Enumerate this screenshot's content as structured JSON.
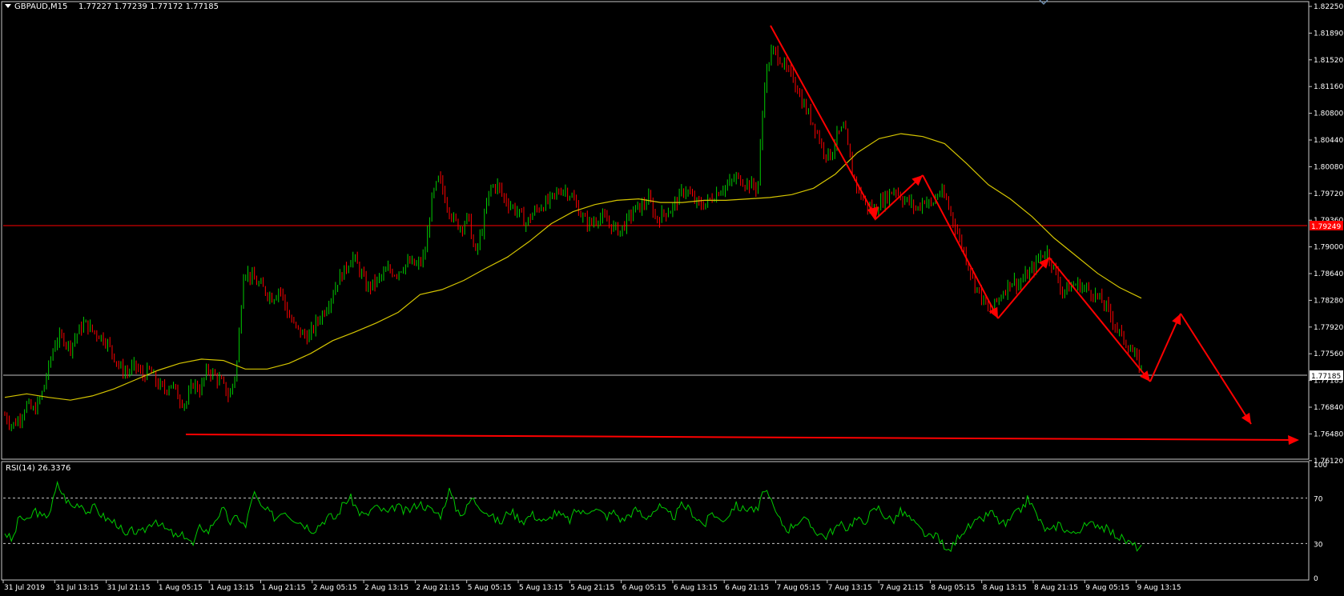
{
  "header": {
    "title": "GBPAUD,M15",
    "ohlc": "1.77227 1.77239 1.77172 1.77185"
  },
  "indicator_label": "RSI(14) 26.3376",
  "colors": {
    "background": "#000000",
    "bull_candle": "#00cc00",
    "bear_candle": "#ff0000",
    "moving_average": "#d4c400",
    "rsi_line": "#00cc00",
    "annotation": "#ff0000",
    "level_line": "#ff0000",
    "bid_line": "#c0c0c0",
    "axis_text": "#ffffff"
  },
  "price_axis": {
    "labels": [
      "1.82250",
      "1.81890",
      "1.81520",
      "1.81160",
      "1.80800",
      "1.80440",
      "1.80080",
      "1.79720",
      "1.79360",
      "1.79000",
      "1.78640",
      "1.78280",
      "1.77920",
      "1.77560",
      "1.77185",
      "1.76840",
      "1.76480",
      "1.76120"
    ],
    "level_tag": "1.79249",
    "bid_tag": "1.77185"
  },
  "rsi_axis": {
    "labels": [
      "100",
      "70",
      "30",
      "0"
    ]
  },
  "time_axis": {
    "labels": [
      "31 Jul 2019",
      "31 Jul 13:15",
      "31 Jul 21:15",
      "1 Aug 05:15",
      "1 Aug 13:15",
      "1 Aug 21:15",
      "2 Aug 05:15",
      "2 Aug 13:15",
      "2 Aug 21:15",
      "5 Aug 05:15",
      "5 Aug 13:15",
      "5 Aug 21:15",
      "6 Aug 05:15",
      "6 Aug 13:15",
      "6 Aug 21:15",
      "7 Aug 05:15",
      "7 Aug 13:15",
      "7 Aug 21:15",
      "8 Aug 05:15",
      "8 Aug 13:15",
      "8 Aug 21:15",
      "9 Aug 05:15",
      "9 Aug 13:15"
    ]
  },
  "chart_data": {
    "type": "candlestick",
    "symbol": "GBPAUD",
    "timeframe": "M15",
    "ylim": [
      1.7595,
      1.8235
    ],
    "levels": {
      "resistance": 1.79249,
      "bid": 1.77185
    },
    "close_path": [
      1.7655,
      1.764,
      1.765,
      1.767,
      1.766,
      1.768,
      1.772,
      1.776,
      1.7765,
      1.775,
      1.777,
      1.7785,
      1.7775,
      1.7768,
      1.776,
      1.774,
      1.772,
      1.7715,
      1.7725,
      1.771,
      1.7718,
      1.77,
      1.769,
      1.77,
      1.768,
      1.767,
      1.77,
      1.769,
      1.772,
      1.771,
      1.77,
      1.768,
      1.772,
      1.786,
      1.785,
      1.784,
      1.783,
      1.782,
      1.7835,
      1.78,
      1.778,
      1.777,
      1.7765,
      1.7785,
      1.78,
      1.782,
      1.7845,
      1.786,
      1.788,
      1.786,
      1.7835,
      1.784,
      1.785,
      1.786,
      1.7855,
      1.7865,
      1.787,
      1.7865,
      1.788,
      1.796,
      1.799,
      1.7955,
      1.793,
      1.792,
      1.7935,
      1.788,
      1.792,
      1.7975,
      1.798,
      1.796,
      1.795,
      1.794,
      1.7925,
      1.794,
      1.795,
      1.7955,
      1.7965,
      1.7975,
      1.7968,
      1.795,
      1.793,
      1.7925,
      1.7935,
      1.793,
      1.792,
      1.7915,
      1.793,
      1.7945,
      1.795,
      1.796,
      1.793,
      1.794,
      1.7945,
      1.796,
      1.7975,
      1.796,
      1.795,
      1.7955,
      1.7965,
      1.7975,
      1.798,
      1.799,
      1.7985,
      1.798,
      1.7975,
      1.813,
      1.817,
      1.816,
      1.814,
      1.813,
      1.81,
      1.808,
      1.806,
      1.803,
      1.802,
      1.805,
      1.806,
      1.8,
      1.797,
      1.795,
      1.7945,
      1.7955,
      1.7965,
      1.7975,
      1.796,
      1.7955,
      1.7945,
      1.796,
      1.795,
      1.797,
      1.796,
      1.793,
      1.79,
      1.787,
      1.784,
      1.782,
      1.78,
      1.7815,
      1.783,
      1.7845,
      1.784,
      1.785,
      1.786,
      1.788,
      1.7885,
      1.786,
      1.783,
      1.7835,
      1.784,
      1.7835,
      1.783,
      1.782,
      1.781,
      1.779,
      1.777,
      1.7755,
      1.774,
      1.77185
    ],
    "ma_path": [
      1.768,
      1.7685,
      1.768,
      1.7676,
      1.7682,
      1.7692,
      1.7705,
      1.7718,
      1.7728,
      1.7734,
      1.7732,
      1.772,
      1.772,
      1.7728,
      1.7742,
      1.776,
      1.7772,
      1.7785,
      1.78,
      1.7825,
      1.7832,
      1.7845,
      1.7862,
      1.7878,
      1.79,
      1.7925,
      1.7942,
      1.7952,
      1.7958,
      1.796,
      1.7955,
      1.7955,
      1.7958,
      1.7958,
      1.796,
      1.7962,
      1.7966,
      1.7975,
      1.7995,
      1.8025,
      1.8045,
      1.8052,
      1.8048,
      1.8038,
      1.801,
      1.798,
      1.796,
      1.7935,
      1.7905,
      1.788,
      1.7855,
      1.7835,
      1.782
    ],
    "rsi": {
      "ylim": [
        0,
        100
      ],
      "levels": [
        70,
        30
      ],
      "last": 26.3376,
      "path": [
        40,
        32,
        55,
        48,
        60,
        52,
        58,
        82,
        70,
        62,
        66,
        58,
        62,
        54,
        50,
        48,
        35,
        42,
        38,
        45,
        52,
        44,
        40,
        35,
        38,
        28,
        46,
        40,
        52,
        60,
        48,
        54,
        44,
        76,
        62,
        58,
        52,
        60,
        54,
        50,
        46,
        42,
        48,
        54,
        52,
        66,
        70,
        58,
        54,
        62,
        60,
        56,
        64,
        58,
        60,
        66,
        62,
        58,
        55,
        78,
        60,
        56,
        70,
        64,
        58,
        52,
        48,
        60,
        54,
        50,
        56,
        52,
        48,
        58,
        54,
        50,
        60,
        56,
        62,
        58,
        54,
        58,
        50,
        56,
        60,
        52,
        58,
        62,
        56,
        54,
        64,
        60,
        52,
        46,
        58,
        50,
        54,
        64,
        60,
        62,
        58,
        80,
        62,
        50,
        42,
        48,
        52,
        46,
        40,
        36,
        42,
        46,
        44,
        52,
        48,
        56,
        62,
        54,
        50,
        58,
        54,
        46,
        40,
        34,
        38,
        22,
        28,
        40,
        44,
        48,
        52,
        58,
        50,
        46,
        54,
        60,
        70,
        56,
        44,
        40,
        48,
        42,
        38,
        44,
        46,
        48,
        44,
        40,
        36,
        32,
        28,
        26
      ]
    },
    "annotations": "red arrows tracing the zigzag trend and projected move"
  }
}
